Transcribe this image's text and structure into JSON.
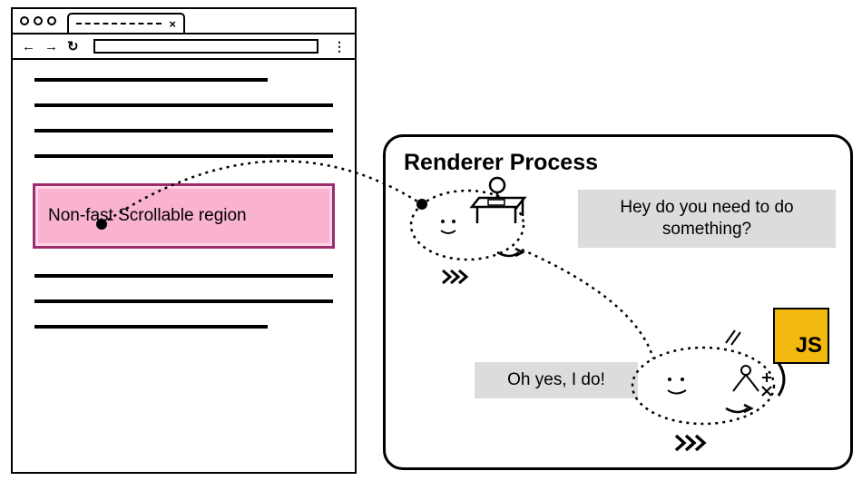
{
  "browser": {
    "back_icon": "←",
    "forward_icon": "→",
    "reload_icon": "↻",
    "tab_close": "×",
    "menu_icon": "⋮"
  },
  "region": {
    "label": "Non-fast Scrollable region"
  },
  "renderer": {
    "title": "Renderer Process",
    "speech1": "Hey do you need to do something?",
    "speech2": "Oh yes, I do!",
    "js_label": "JS"
  }
}
